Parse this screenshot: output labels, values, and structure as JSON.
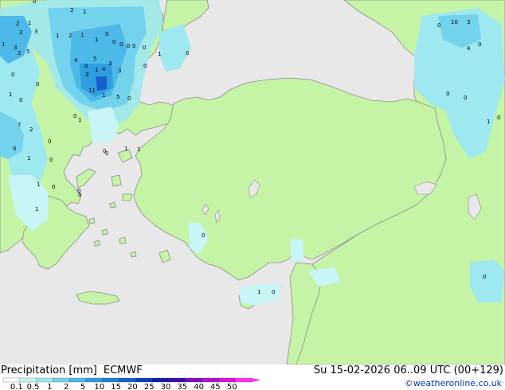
{
  "map": {
    "colors": {
      "sea": "#e8e8e8",
      "land": "#c6f4a6",
      "coast": "#8c8c8c",
      "border": "#7a7a7a"
    },
    "precip_values": [
      "0",
      "2",
      "1",
      "2",
      "1",
      "3",
      "1",
      "1",
      "0",
      "2",
      "1",
      "1",
      "3",
      "5",
      "4",
      "0",
      "3",
      "0",
      "0",
      "0",
      "1",
      "2",
      "5",
      "3",
      "3",
      "4",
      "11",
      "1",
      "5",
      "0",
      "0",
      "1",
      "7",
      "2",
      "0",
      "1",
      "1",
      "0",
      "0",
      "1",
      "0",
      "0",
      "0",
      "1",
      "2",
      "0",
      "0",
      "0",
      "0",
      "1",
      "1",
      "0",
      "0",
      "0",
      "0",
      "1",
      "0",
      "10",
      "3",
      "4",
      "0",
      "0",
      "0",
      "0",
      "1",
      "0",
      "0",
      "1",
      "0",
      "0"
    ]
  },
  "footer": {
    "title": "Precipitation [mm]",
    "model": "ECMWF",
    "valid": "Su 15-02-2026 06..09 UTC (00+129)",
    "credit": "©weatheronline.co.uk"
  },
  "legend": {
    "ticks": [
      "0.1",
      "0.5",
      "1",
      "2",
      "5",
      "10",
      "15",
      "20",
      "25",
      "30",
      "35",
      "40",
      "45",
      "50"
    ],
    "colors": [
      "#ffffff",
      "#c8f5f5",
      "#9ee8f0",
      "#73d2ec",
      "#4cb9e8",
      "#2f9ee0",
      "#1f7fd6",
      "#1460cc",
      "#0a3fb8",
      "#101caa",
      "#3a0fb0",
      "#7a10c0",
      "#b010d0",
      "#e010e0",
      "#ff30f0"
    ]
  }
}
